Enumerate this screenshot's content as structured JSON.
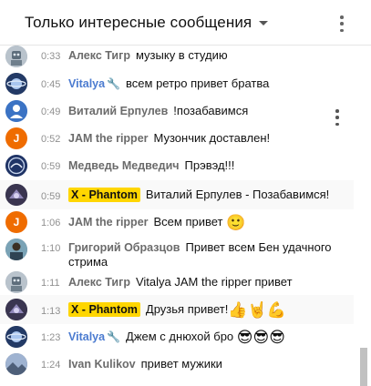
{
  "header": {
    "title": "Только интересные сообщения",
    "dropdown_icon": "caret-down-icon",
    "menu_icon": "more-vertical-icon"
  },
  "messages": [
    {
      "time": "0:33",
      "author": "Алекс Тигр",
      "text": "музыку в студию",
      "avatar": "robot-avatar",
      "author_style": "gray"
    },
    {
      "time": "0:45",
      "author": "Vitalya",
      "moderator_icon": "wrench-icon",
      "text": "всем ретро привет братва",
      "avatar": "planet-avatar",
      "author_style": "blue"
    },
    {
      "time": "0:49",
      "author": "Виталий Ерпулев",
      "text": "!позабавимся",
      "avatar": "default-user-avatar",
      "author_style": "gray"
    },
    {
      "time": "0:52",
      "author": "JAM the ripper",
      "text": "Музончик доставлен!",
      "avatar": "letter-avatar",
      "avatar_letter": "J",
      "author_style": "gray"
    },
    {
      "time": "0:59",
      "author": "Медведь Медведич",
      "text": "Прэвэд!!!",
      "avatar": "logo-avatar",
      "author_style": "gray"
    },
    {
      "time": "0:59",
      "author": "X - Phantom",
      "text": "Виталий Ерпулев - Позабавимся!",
      "avatar": "dark-avatar",
      "author_style": "sponsor"
    },
    {
      "time": "1:06",
      "author": "JAM the ripper",
      "text": "Всем привет",
      "emoji": "🙂",
      "avatar": "letter-avatar",
      "avatar_letter": "J",
      "author_style": "gray"
    },
    {
      "time": "1:10",
      "author": "Григорий Образцов",
      "text": "Привет всем Бен удачного стрима",
      "avatar": "photo-avatar",
      "author_style": "gray"
    },
    {
      "time": "1:11",
      "author": "Алекс Тигр",
      "text": "Vitalya JAM the ripper привет",
      "avatar": "robot-avatar",
      "author_style": "gray"
    },
    {
      "time": "1:13",
      "author": "X - Phantom",
      "text": "Друзья привет!",
      "emoji": "👍🤘💪",
      "avatar": "dark-avatar",
      "author_style": "sponsor"
    },
    {
      "time": "1:23",
      "author": "Vitalya",
      "moderator_icon": "wrench-icon",
      "text": "Джем с днюхой бро",
      "emoji": "😎😎😎",
      "avatar": "planet-avatar",
      "author_style": "blue"
    },
    {
      "time": "1:24",
      "author": "Ivan Kulikov",
      "text": "привет мужики",
      "avatar": "landscape-avatar",
      "author_style": "gray"
    }
  ],
  "colors": {
    "sponsor_badge": "#ffd600",
    "moderator_name": "#4b7bd0",
    "author_name": "#6b6b6b",
    "timestamp": "#909090",
    "letter_avatar": "#ef6c00",
    "default_avatar": "#3b73c4"
  }
}
